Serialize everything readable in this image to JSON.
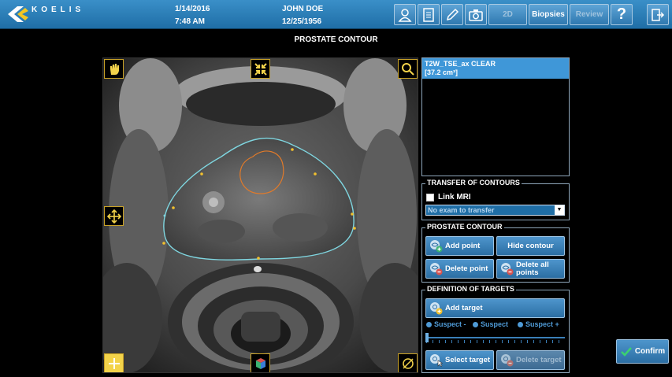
{
  "header": {
    "logo_text": "KOELIS",
    "date": "1/14/2016",
    "time": "7:48 AM",
    "patient_name": "JOHN DOE",
    "patient_dob": "12/25/1956",
    "buttons": {
      "patient_icon": "patient-icon",
      "report_icon": "document-icon",
      "edit_icon": "pencil-icon",
      "camera_icon": "camera-icon",
      "view_2d": "2D",
      "biopsies": "Biopsies",
      "review": "Review",
      "help": "?",
      "exit_icon": "exit-icon"
    }
  },
  "page_title": "PROSTATE CONTOUR",
  "viewer": {
    "tools": [
      "hand-icon",
      "shrink-icon",
      "magnifier-icon",
      "move-icon",
      "flip-icon",
      "cube-icon",
      "no-rotate-icon"
    ]
  },
  "series": {
    "item_name": "T2W_TSE_ax CLEAR",
    "item_volume": "[37.2 cm³]"
  },
  "transfer": {
    "title": "TRANSFER OF CONTOURS",
    "link_mri": "Link MRI",
    "exam_select": "No exam to transfer"
  },
  "prostate_contour": {
    "title": "PROSTATE CONTOUR",
    "add_point": "Add point",
    "hide_contour": "Hide contour",
    "delete_point": "Delete point",
    "delete_all_line1": "Delete all",
    "delete_all_line2": "points"
  },
  "targets": {
    "title": "DEFINITION OF TARGETS",
    "add_target": "Add target",
    "suspect_minus": "Suspect -",
    "suspect": "Suspect",
    "suspect_plus": "Suspect +",
    "select_target": "Select target",
    "delete_target": "Delete target"
  },
  "confirm": "Confirm",
  "colors": {
    "accent": "#3f97d8",
    "contour": "#7fd6e0",
    "target": "#e07a2a",
    "points": "#f2c12e",
    "tool_border": "#c9a227"
  }
}
